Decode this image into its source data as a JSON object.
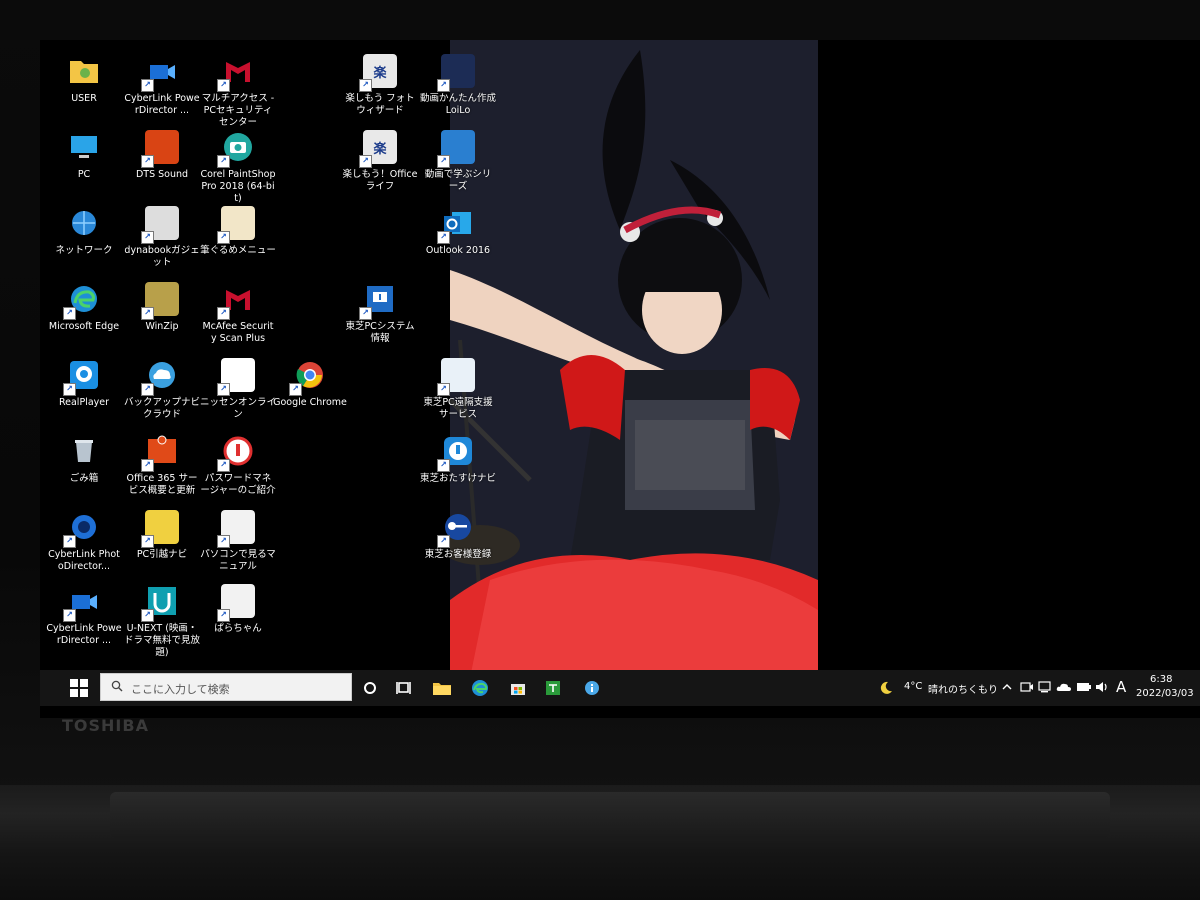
{
  "brand": "TOSHIBA",
  "desktop_icons": [
    {
      "label": "USER",
      "color": "#e8b84a",
      "glyph": "folder"
    },
    {
      "label": "CyberLink PowerDirector ...",
      "color": "#1b6fd6",
      "glyph": "clapper"
    },
    {
      "label": "マルチアクセス - PCセキュリティセンター",
      "color": "#c8102e",
      "glyph": "M"
    },
    {
      "label": "楽しもう フォト ウィザード",
      "color": "#e9e9e9",
      "glyph": "楽"
    },
    {
      "label": "動画かんたん作成 LoiLo",
      "color": "#1c2c55",
      "glyph": "disc"
    },
    {
      "label": "PC",
      "color": "#2aa4e8",
      "glyph": "monitor"
    },
    {
      "label": "DTS Sound",
      "color": "#d94414",
      "glyph": "dts"
    },
    {
      "label": "Corel PaintShop Pro 2018 (64-bit)",
      "color": "#21a7a0",
      "glyph": "camera"
    },
    {
      "label": "楽しもう！Office ライフ",
      "color": "#e9e9e9",
      "glyph": "楽"
    },
    {
      "label": "動画で学ぶシリーズ",
      "color": "#2a7fd0",
      "glyph": "fish"
    },
    {
      "label": "ネットワーク",
      "color": "#2a88d8",
      "glyph": "globe"
    },
    {
      "label": "dynabookガジェット",
      "color": "#dddddd",
      "glyph": "gadget"
    },
    {
      "label": "筆ぐるめメニュー",
      "color": "#f2e6c8",
      "glyph": "brush"
    },
    {
      "label": "Outlook 2016",
      "color": "#0f6cbd",
      "glyph": "O"
    },
    {
      "label": "Microsoft Edge",
      "color": "#1e8fd6",
      "glyph": "edge"
    },
    {
      "label": "WinZip",
      "color": "#b8a04a",
      "glyph": "zip"
    },
    {
      "label": "McAfee Security Scan Plus",
      "color": "#c8102e",
      "glyph": "M"
    },
    {
      "label": "東芝PCシステム情報",
      "color": "#1f6bc4",
      "glyph": "i"
    },
    {
      "label": "RealPlayer",
      "color": "#1a8fe3",
      "glyph": "real"
    },
    {
      "label": "バックアップナビ クラウド",
      "color": "#3aa0e0",
      "glyph": "cloud"
    },
    {
      "label": "ニッセンオンライン",
      "color": "#ffffff",
      "glyph": "nissen"
    },
    {
      "label": "Google Chrome",
      "color": "#dd4b3a",
      "glyph": "chrome"
    },
    {
      "label": "東芝PC遠隔支援サービス",
      "color": "#e9f1f8",
      "glyph": "remote"
    },
    {
      "label": "ごみ箱",
      "color": "#b8c4cf",
      "glyph": "bin"
    },
    {
      "label": "Office 365 サービス概要と更新",
      "color": "#e04a18",
      "glyph": "o365"
    },
    {
      "label": "パスワードマネージャーのご紹介",
      "color": "#e03030",
      "glyph": "pw"
    },
    {
      "label": "東芝おたすけナビ",
      "color": "#1f88d8",
      "glyph": "thumb"
    },
    {
      "label": "CyberLink PhotoDirector...",
      "color": "#1e6fd6",
      "glyph": "aperture"
    },
    {
      "label": "PC引越ナビ",
      "color": "#f0d040",
      "glyph": "move"
    },
    {
      "label": "パソコンで見るマニュアル",
      "color": "#f2f2f2",
      "glyph": "manual"
    },
    {
      "label": "東芝お客様登録",
      "color": "#1848a0",
      "glyph": "key"
    },
    {
      "label": "CyberLink PowerDirector ...",
      "color": "#1b6fd6",
      "glyph": "clapper"
    },
    {
      "label": "U-NEXT (映画・ドラマ無料で見放題)",
      "color": "#0f9fb0",
      "glyph": "U"
    },
    {
      "label": "ぱらちゃん",
      "color": "#f2f2f2",
      "glyph": "para"
    }
  ],
  "taskbar": {
    "search_placeholder": "ここに入力して検索",
    "pinned": [
      "task-view",
      "explorer",
      "edge",
      "store",
      "ichitaro",
      "info"
    ],
    "weather_temp": "4°C",
    "weather_text": "晴れのちくもり",
    "ime": "A",
    "time": "6:38",
    "date": "2022/03/03"
  },
  "colors": {
    "taskbar": "#151515",
    "accent": "#0f6cbd"
  }
}
